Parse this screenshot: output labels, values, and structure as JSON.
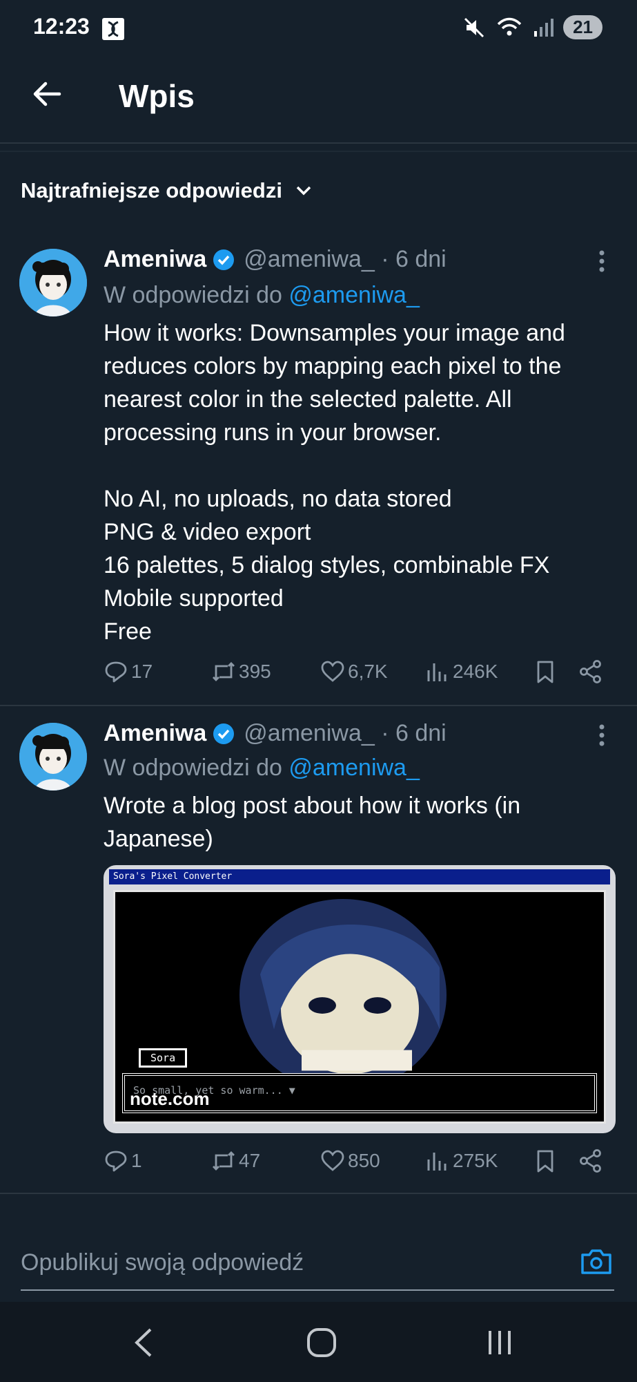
{
  "status_bar": {
    "time": "12:23",
    "battery": "21",
    "icons": [
      "app-icon",
      "mute-icon",
      "wifi-icon",
      "signal-icon"
    ]
  },
  "header": {
    "title": "Wpis",
    "back_icon": "back-arrow-icon"
  },
  "sort": {
    "label": "Najtrafniejsze odpowiedzi",
    "icon": "chevron-down-icon"
  },
  "tweets": [
    {
      "name": "Ameniwa",
      "verified": true,
      "handle": "@ameniwa_ · 6 dni",
      "reply_prefix": "W odpowiedzi do ",
      "reply_mention": "@ameniwa_",
      "text": "How it works: Downsamples your image and reduces colors by mapping each pixel to the nearest color in the selected palette. All processing runs in your browser.\n\nNo AI, no uploads, no data stored\nPNG & video export\n16 palettes, 5 dialog styles, combinable FX\nMobile supported\nFree",
      "stats": {
        "replies": "17",
        "reposts": "395",
        "likes": "6,7K",
        "views": "246K"
      }
    },
    {
      "name": "Ameniwa",
      "verified": true,
      "handle": "@ameniwa_ · 6 dni",
      "reply_prefix": "W odpowiedzi do ",
      "reply_mention": "@ameniwa_",
      "text": "Wrote a blog post about how it works (in Japanese)",
      "media": {
        "window_title": "Sora's Pixel Converter",
        "speaker": "Sora",
        "dialog": "So small, yet so warm... ▼",
        "link_label": "note.com"
      },
      "stats": {
        "replies": "1",
        "reposts": "47",
        "likes": "850",
        "views": "275K"
      }
    }
  ],
  "reply_bar": {
    "placeholder": "Opublikuj swoją odpowiedź",
    "icon": "camera-icon"
  },
  "colors": {
    "background": "#15202b",
    "accent": "#1d9bf0",
    "muted": "#8b98a5"
  }
}
